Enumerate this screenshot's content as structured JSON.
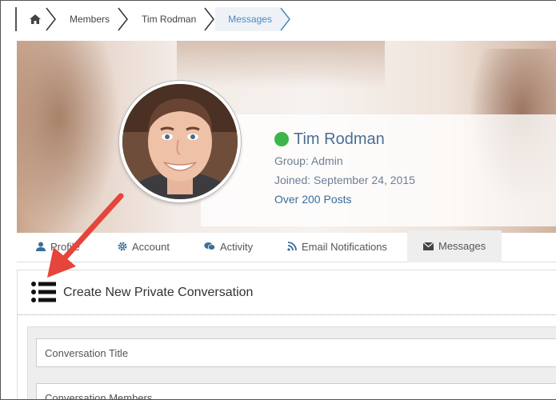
{
  "breadcrumb": {
    "home_icon": "home-icon",
    "items": [
      "Members",
      "Tim Rodman"
    ],
    "active": "Messages"
  },
  "profile": {
    "name": "Tim Rodman",
    "status_color": "#3cb54a",
    "group": "Group: Admin",
    "joined": "Joined: September 24, 2015",
    "posts": "Over 200 Posts"
  },
  "tabs": [
    {
      "label": "Profile",
      "icon": "user-icon"
    },
    {
      "label": "Account",
      "icon": "gear-icon"
    },
    {
      "label": "Activity",
      "icon": "comments-icon"
    },
    {
      "label": "Email Notifications",
      "icon": "rss-icon"
    },
    {
      "label": "Messages",
      "icon": "envelope-icon",
      "active": true
    }
  ],
  "panel": {
    "title": "Create New Private Conversation",
    "fields": [
      "Conversation Title",
      "Conversation Members"
    ]
  },
  "colors": {
    "accent": "#4a8bc2",
    "annotation_arrow": "#e5453a"
  }
}
